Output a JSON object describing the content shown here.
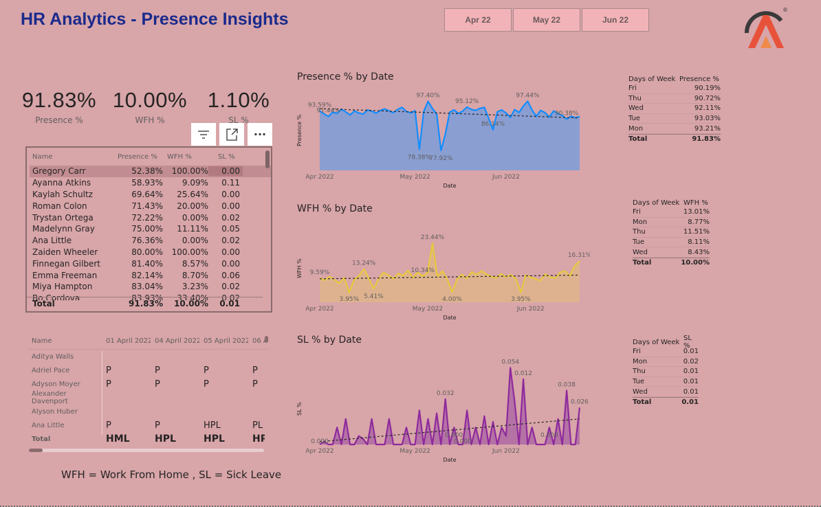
{
  "title": "HR Analytics - Presence Insights",
  "month_slicer": [
    "Apr 22",
    "May 22",
    "Jun 22"
  ],
  "logo_mark": "®",
  "kpis": [
    {
      "value": "91.83%",
      "label": "Presence %"
    },
    {
      "value": "10.00%",
      "label": "WFH %"
    },
    {
      "value": "1.10%",
      "label": "SL %"
    }
  ],
  "toolbar": {
    "filter_icon": "filter-icon",
    "focus_icon": "focus-mode-icon",
    "more_label": "···"
  },
  "employee_table": {
    "headers": [
      "Name",
      "Presence %",
      "WFH %",
      "SL %"
    ],
    "rows": [
      [
        "Gregory Carr",
        "52.38%",
        "100.00%",
        "0.00"
      ],
      [
        "Ayanna Atkins",
        "58.93%",
        "9.09%",
        "0.11"
      ],
      [
        "Kaylah Schultz",
        "69.64%",
        "25.64%",
        "0.00"
      ],
      [
        "Roman Colon",
        "71.43%",
        "20.00%",
        "0.00"
      ],
      [
        "Trystan Ortega",
        "72.22%",
        "0.00%",
        "0.02"
      ],
      [
        "Madelynn Gray",
        "75.00%",
        "11.11%",
        "0.05"
      ],
      [
        "Ana Little",
        "76.36%",
        "0.00%",
        "0.02"
      ],
      [
        "Zaiden Wheeler",
        "80.00%",
        "100.00%",
        "0.00"
      ],
      [
        "Finnegan Gilbert",
        "81.40%",
        "8.57%",
        "0.00"
      ],
      [
        "Emma Freeman",
        "82.14%",
        "8.70%",
        "0.06"
      ],
      [
        "Miya Hampton",
        "83.04%",
        "3.23%",
        "0.02"
      ],
      [
        "Bo Cordova",
        "83.93%",
        "33.40%",
        "0.02"
      ]
    ],
    "total": [
      "Total",
      "91.83%",
      "10.00%",
      "0.01"
    ]
  },
  "matrix": {
    "headers": [
      "Name",
      "01 April 2022",
      "04 April 2022",
      "05 April 2022",
      "06 A"
    ],
    "rows": [
      [
        "Aditya Walls",
        "",
        "",
        "",
        ""
      ],
      [
        "Adriel Pace",
        "P",
        "P",
        "P",
        "P"
      ],
      [
        "Adyson Moyer",
        "P",
        "P",
        "P",
        "P"
      ],
      [
        "Alexander Davenport",
        "",
        "",
        "",
        ""
      ],
      [
        "Alyson Huber",
        "",
        "",
        "",
        ""
      ],
      [
        "Ana Little",
        "P",
        "P",
        "HPL",
        "PL"
      ]
    ],
    "total": [
      "Total",
      "HML",
      "HPL",
      "HPL",
      "HP"
    ]
  },
  "footnote": "WFH = Work From Home , SL = Sick Leave",
  "presence_chart": {
    "title": "Presence % by Date",
    "ylabel": "Presence %",
    "xlabel": "Date",
    "x_ticks": [
      "Apr 2022",
      "May 2022",
      "Jun 2022"
    ],
    "labels": [
      "93.59%",
      "97.40%",
      "95.12%",
      "78.38%",
      "77.92%",
      "86.14%",
      "97.44%",
      "90.38%",
      "91.44%"
    ]
  },
  "wfh_chart": {
    "title": "WFH % by Date",
    "ylabel": "WFH %",
    "xlabel": "Date",
    "x_ticks": [
      "Apr 2022",
      "May 2022",
      "Jun 2022"
    ],
    "labels": [
      "9.59%",
      "13.24%",
      "3.95%",
      "5.41%",
      "23.44%",
      "10.34%",
      "4.00%",
      "3.95%",
      "16.31%"
    ]
  },
  "sl_chart": {
    "title": "SL % by Date",
    "ylabel": "SL %",
    "xlabel": "Date",
    "x_ticks": [
      "Apr 2022",
      "May 2022",
      "Jun 2022"
    ],
    "labels": [
      "0.000",
      "0.032",
      "0.000",
      "0.000",
      "0.054",
      "0.012",
      "0.038",
      "0.026",
      "0.000"
    ]
  },
  "chart_data": [
    {
      "type": "area",
      "title": "Presence % by Date",
      "xlabel": "Date",
      "ylabel": "Presence %",
      "x": [
        "Apr 2022",
        "",
        "",
        "",
        "",
        "",
        "",
        "",
        "",
        "",
        "",
        "",
        "",
        "",
        "",
        "",
        "",
        "",
        "",
        "",
        "",
        "",
        "May 2022",
        "",
        "",
        "",
        "",
        "",
        "",
        "",
        "",
        "",
        "",
        "",
        "",
        "",
        "",
        "",
        "",
        "",
        "",
        "",
        "",
        "Jun 2022",
        "",
        "",
        "",
        "",
        "",
        "",
        "",
        "",
        "",
        "",
        "",
        "",
        "",
        "",
        "",
        "",
        ""
      ],
      "series": [
        {
          "values": [
            93.59,
            92.4,
            91.44,
            93.1,
            92.6,
            94.3,
            93.2,
            92.0,
            93.6,
            92.8,
            92.3,
            94.0,
            93.5,
            92.7,
            93.8,
            94.4,
            93.6,
            92.9,
            94.2,
            95.0,
            93.4,
            92.8,
            93.7,
            78.38,
            93.3,
            97.4,
            94.6,
            92.3,
            77.92,
            84.5,
            93.1,
            94.0,
            92.6,
            93.5,
            95.12,
            94.2,
            93.8,
            94.6,
            95.0,
            90.7,
            86.14,
            93.2,
            94.0,
            92.8,
            91.0,
            94.1,
            93.0,
            95.5,
            97.44,
            94.0,
            91.5,
            93.8,
            92.9,
            91.2,
            93.6,
            92.5,
            91.8,
            90.38,
            91.5,
            90.9,
            91.4
          ]
        }
      ],
      "trendline": [
        94.5,
        90.8
      ],
      "ylim": [
        70,
        100
      ]
    },
    {
      "type": "area",
      "title": "WFH % by Date",
      "xlabel": "Date",
      "ylabel": "WFH %",
      "x": [
        "Apr 2022",
        "",
        "",
        "",
        "",
        "",
        "",
        "",
        "",
        "",
        "",
        "",
        "",
        "",
        "",
        "",
        "",
        "",
        "",
        "",
        "",
        "",
        "May 2022",
        "",
        "",
        "",
        "",
        "",
        "",
        "",
        "",
        "",
        "",
        "",
        "",
        "",
        "",
        "",
        "",
        "",
        "",
        "",
        "",
        "Jun 2022",
        "",
        "",
        "",
        "",
        "",
        "",
        "",
        "",
        "",
        "",
        "",
        "",
        "",
        "",
        "",
        "",
        ""
      ],
      "series": [
        {
          "values": [
            9.59,
            8.8,
            10.2,
            9.0,
            7.5,
            9.8,
            3.95,
            8.9,
            10.5,
            13.24,
            9.6,
            5.41,
            9.4,
            11.8,
            10.8,
            9.3,
            11.4,
            10.6,
            12.6,
            9.8,
            11.9,
            10.34,
            11.8,
            23.44,
            10.2,
            12.4,
            9.3,
            4.0,
            9.2,
            11.1,
            9.4,
            12.1,
            10.9,
            12.4,
            11.1,
            10.2,
            9.7,
            11.3,
            10.1,
            10.9,
            9.4,
            3.95,
            10.8,
            9.9,
            9.3,
            8.6,
            11.2,
            10.0,
            9.6,
            11.8,
            12.4,
            10.4,
            14.5,
            16.31
          ]
        }
      ],
      "trendline": [
        9.3,
        10.8
      ],
      "ylim": [
        0,
        30
      ]
    },
    {
      "type": "area",
      "title": "SL % by Date",
      "xlabel": "Date",
      "ylabel": "SL %",
      "x": [
        "Apr 2022",
        "",
        "",
        "",
        "",
        "",
        "",
        "",
        "",
        "",
        "",
        "",
        "",
        "",
        "",
        "",
        "",
        "",
        "",
        "",
        "",
        "",
        "May 2022",
        "",
        "",
        "",
        "",
        "",
        "",
        "",
        "",
        "",
        "",
        "",
        "",
        "",
        "",
        "",
        "",
        "",
        "",
        "",
        "",
        "Jun 2022",
        "",
        "",
        "",
        "",
        "",
        "",
        "",
        "",
        "",
        "",
        "",
        "",
        "",
        "",
        "",
        "",
        ""
      ],
      "series": [
        {
          "values": [
            0.0,
            0.002,
            0.0,
            0.0,
            0.012,
            0.0,
            0.018,
            0.0,
            0.0,
            0.006,
            0.004,
            0.0,
            0.018,
            0.0,
            0.0,
            0.0,
            0.018,
            0.0,
            0.0,
            0.0,
            0.012,
            0.0,
            0.0,
            0.024,
            0.0,
            0.018,
            0.0,
            0.022,
            0.0,
            0.032,
            0.0,
            0.012,
            0.0,
            0.0,
            0.024,
            0.0,
            0.012,
            0.0,
            0.02,
            0.0,
            0.016,
            0.0,
            0.012,
            0.006,
            0.054,
            0.03,
            0.0,
            0.046,
            0.0,
            0.012,
            0.0,
            0.0,
            0.0,
            0.012,
            0.0,
            0.018,
            0.0,
            0.038,
            0.0,
            0.0,
            0.026
          ]
        }
      ],
      "trendline": [
        0.002,
        0.018
      ],
      "ylim": [
        0,
        0.06
      ]
    },
    {
      "type": "table",
      "title": "",
      "columns": [
        "Days of Week",
        "Presence %"
      ],
      "rows": [
        [
          "Fri",
          "90.19%"
        ],
        [
          "Thu",
          "90.72%"
        ],
        [
          "Wed",
          "92.11%"
        ],
        [
          "Tue",
          "93.03%"
        ],
        [
          "Mon",
          "93.21%"
        ]
      ],
      "total": [
        "Total",
        "91.83%"
      ]
    },
    {
      "type": "table",
      "title": "",
      "columns": [
        "Days of Week",
        "WFH %"
      ],
      "rows": [
        [
          "Fri",
          "13.01%"
        ],
        [
          "Mon",
          "8.77%"
        ],
        [
          "Thu",
          "11.51%"
        ],
        [
          "Tue",
          "8.11%"
        ],
        [
          "Wed",
          "8.43%"
        ]
      ],
      "total": [
        "Total",
        "10.00%"
      ]
    },
    {
      "type": "table",
      "title": "",
      "columns": [
        "Days of Week",
        "SL %"
      ],
      "rows": [
        [
          "Fri",
          "0.01"
        ],
        [
          "Mon",
          "0.02"
        ],
        [
          "Thu",
          "0.01"
        ],
        [
          "Tue",
          "0.01"
        ],
        [
          "Wed",
          "0.01"
        ]
      ],
      "total": [
        "Total",
        "0.01"
      ]
    }
  ],
  "colors": {
    "background": "#d8a5a9",
    "title": "#1a2a8c",
    "presence_line": "#118dff",
    "presence_fill": "#8a9ed2",
    "wfh_line": "#e8c83d",
    "wfh_fill": "#deb28f",
    "sl_line": "#8e2a9c",
    "sl_fill": "#b472a5"
  }
}
